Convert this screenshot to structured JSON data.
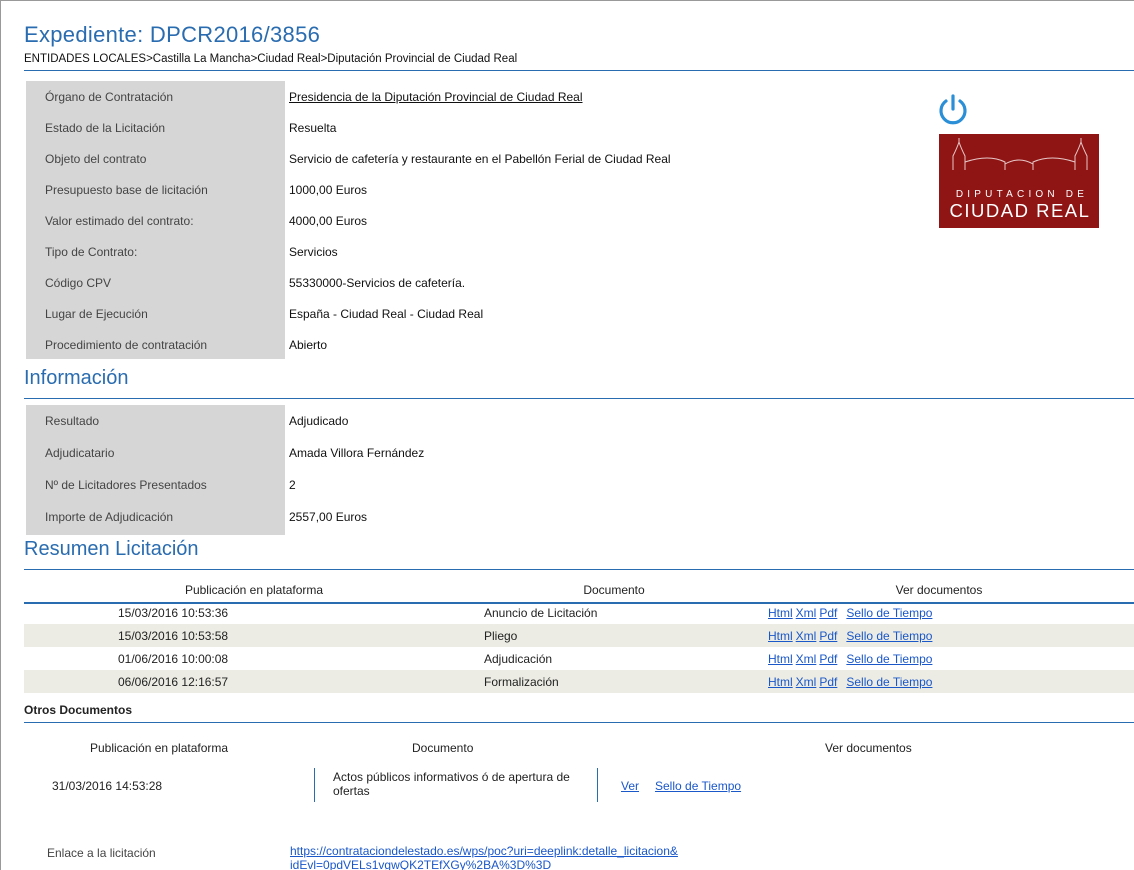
{
  "header": {
    "title": "Expediente:  DPCR2016/3856",
    "breadcrumb": "ENTIDADES LOCALES>Castilla La Mancha>Ciudad Real>Diputación Provincial de Ciudad Real"
  },
  "details": [
    {
      "label": "Órgano de Contratación",
      "value": "Presidencia de la Diputación Provincial de Ciudad Real",
      "link": true
    },
    {
      "label": "Estado de la Licitación",
      "value": "Resuelta"
    },
    {
      "label": "Objeto del contrato",
      "value": "Servicio de cafetería y restaurante en el Pabellón Ferial de Ciudad Real"
    },
    {
      "label": "Presupuesto base de licitación",
      "value": "1000,00  Euros"
    },
    {
      "label": "Valor estimado del contrato:",
      "value": "4000,00  Euros"
    },
    {
      "label": "Tipo de Contrato:",
      "value": "Servicios"
    },
    {
      "label": "Código CPV",
      "value": "55330000-Servicios de cafetería."
    },
    {
      "label": "Lugar de Ejecución",
      "value": "España - Ciudad Real - Ciudad Real"
    },
    {
      "label": "Procedimiento de contratación",
      "value": "Abierto"
    }
  ],
  "logo": {
    "line1": "DIPUTACION DE",
    "line2": "CIUDAD REAL",
    "color": "#8f1515"
  },
  "info": {
    "title": "Información",
    "rows": [
      {
        "label": "Resultado",
        "value": "Adjudicado"
      },
      {
        "label": "Adjudicatario",
        "value": "Amada Villora Fernández"
      },
      {
        "label": "Nº de Licitadores Presentados",
        "value": "2"
      },
      {
        "label": "Importe de Adjudicación",
        "value": "2557,00  Euros"
      }
    ]
  },
  "summary": {
    "title": "Resumen Licitación",
    "headers": [
      "Publicación en plataforma",
      "Documento",
      "Ver documentos"
    ],
    "rows": [
      {
        "date": "15/03/2016 10:53:36",
        "doc": "Anuncio de Licitación"
      },
      {
        "date": "15/03/2016 10:53:58",
        "doc": "Pliego"
      },
      {
        "date": "01/06/2016 10:00:08",
        "doc": "Adjudicación"
      },
      {
        "date": "06/06/2016 12:16:57",
        "doc": "Formalización"
      }
    ],
    "links": {
      "html": "Html",
      "xml": "Xml",
      "pdf": "Pdf",
      "seal": "Sello de Tiempo"
    }
  },
  "other": {
    "title": "Otros Documentos",
    "headers": [
      "Publicación en plataforma",
      "Documento",
      "Ver documentos"
    ],
    "rows": [
      {
        "date": "31/03/2016 14:53:28",
        "doc": "Actos públicos informativos ó de apertura de ofertas",
        "view": "Ver",
        "seal": "Sello de Tiempo"
      }
    ]
  },
  "enlace": {
    "label": "Enlace a la licitación",
    "url_line1": "https://contrataciondelestado.es/wps/poc?uri=deeplink:detalle_licitacion&",
    "url_line2": "idEvl=0pdVELs1vgwQK2TEfXGy%2BA%3D%3D"
  },
  "colors": {
    "accent": "#2a6cb0",
    "label_bg": "#d6d6d6",
    "stripe": "#ecece4",
    "link": "#1a57c8"
  }
}
